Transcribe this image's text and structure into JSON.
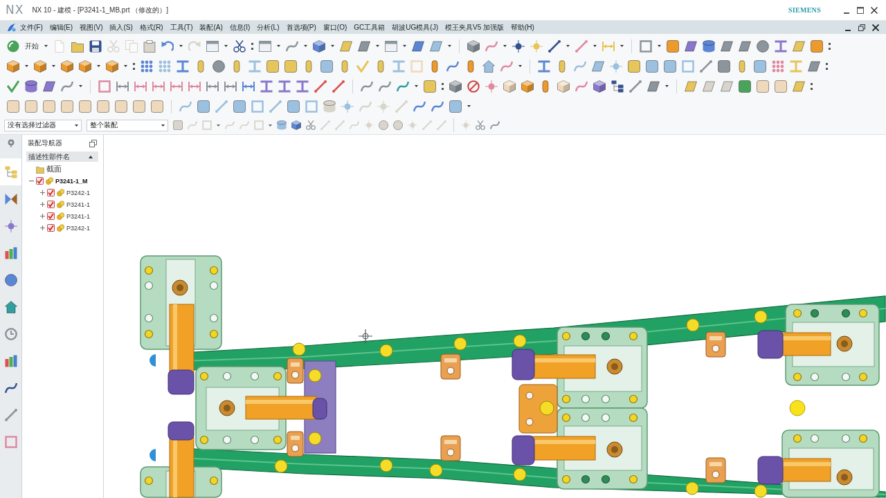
{
  "window": {
    "logo": "NX",
    "title": "NX 10 - 建模 - [P3241-1_MB.prt （修改的）]",
    "brand": "SIEMENS"
  },
  "menu_bar": {
    "items": [
      "文件(F)",
      "编辑(E)",
      "视图(V)",
      "插入(S)",
      "格式(R)",
      "工具(T)",
      "装配(A)",
      "信息(I)",
      "分析(L)",
      "首选项(P)",
      "窗口(O)",
      "GC工具箱",
      "胡波UG模具(J)",
      "模王夹具V5 加强版",
      "帮助(H)"
    ]
  },
  "toolbar": {
    "start_label": "开始",
    "selection_filters": [
      {
        "value": "没有选择过滤器"
      },
      {
        "value": "整个装配"
      }
    ]
  },
  "resource_bar": {
    "tabs": [
      {
        "selected": true
      },
      {
        "selected": false
      },
      {
        "selected": false
      },
      {
        "selected": false
      },
      {
        "selected": false
      },
      {
        "selected": false
      },
      {
        "selected": false
      },
      {
        "selected": false
      },
      {
        "selected": false
      },
      {
        "selected": false
      },
      {
        "selected": false
      }
    ]
  },
  "assembly_navigator": {
    "title": "装配导航器",
    "column": "描述性部件名",
    "tree": [
      {
        "label": "截面",
        "kind": "folder"
      },
      {
        "label": "P3241-1_M",
        "kind": "assembly",
        "expanded": true,
        "checked": true,
        "children": [
          {
            "label": "P3242-1",
            "kind": "part",
            "expanded": false,
            "checked": true
          },
          {
            "label": "P3241-1",
            "kind": "part",
            "expanded": false,
            "checked": true
          },
          {
            "label": "P3241-1",
            "kind": "part",
            "expanded": false,
            "checked": true
          },
          {
            "label": "P3242-1",
            "kind": "part",
            "expanded": false,
            "checked": true
          }
        ]
      }
    ]
  }
}
